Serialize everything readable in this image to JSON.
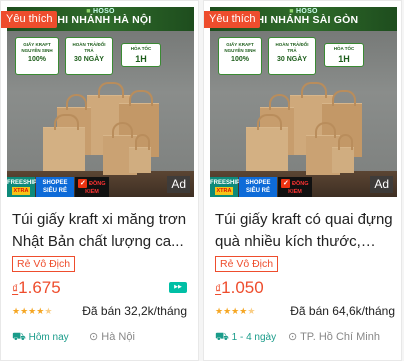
{
  "products": [
    {
      "favorite_label": "Yêu thích",
      "image": {
        "brand": "HOSO",
        "branch": "CHI NHÁNH HÀ NỘI",
        "badge1_small": "GIẤY KRAFT NGUYÊN SINH",
        "badge1_large": "100%",
        "badge2_small": "HOÀN TRẢ/ĐỔI TRẢ",
        "badge2_large": "30 NGÀY",
        "badge3_small": "HỎA TỐC",
        "badge3_large": "1H",
        "promo_freeship": "FREESHIP",
        "promo_freeship_x": "XTRA",
        "promo_shopee": "SHOPEE",
        "promo_sieure": "SIÊU RẺ",
        "promo_dongkiem": "ĐỒNG KIỂM",
        "ad_label": "Ad"
      },
      "title": "Túi giấy kraft xi măng trơn Nhật Bản chất lượng ca...",
      "tag": "Rẻ Vô Địch",
      "currency": "₫",
      "price": "1.675",
      "rating": 4.5,
      "sold": "Đã bán 32,2k/tháng",
      "shipping": "Hôm nay",
      "location": "Hà Nội"
    },
    {
      "favorite_label": "Yêu thích",
      "image": {
        "brand": "HOSO",
        "branch": "CHI NHÁNH SÀI GÒN",
        "badge1_small": "GIẤY KRAFT NGUYÊN SINH",
        "badge1_large": "100%",
        "badge2_small": "HOÀN TRẢ/ĐỔI TRẢ",
        "badge2_large": "30 NGÀY",
        "badge3_small": "HỎA TỐC",
        "badge3_large": "1H",
        "promo_freeship": "FREESHIP",
        "promo_freeship_x": "XTRA",
        "promo_shopee": "SHOPEE",
        "promo_sieure": "SIÊU RẺ",
        "promo_dongkiem": "ĐỒNG KIỂM",
        "ad_label": "Ad"
      },
      "title": "Túi giấy kraft có quai đựng quà nhiều kích thước, túi...",
      "tag": "Rẻ Vô Địch",
      "currency": "₫",
      "price": "1.050",
      "rating": 4.5,
      "sold": "Đã bán 64,6k/tháng",
      "shipping": "1 - 4 ngày",
      "location": "TP. Hồ Chí Minh"
    }
  ],
  "colors": {
    "accent": "#ee4d2d",
    "rating": "#f5a623",
    "shipping": "#1a9c8a"
  },
  "icons": {
    "stars": "star-icon",
    "truck": "truck-icon",
    "location": "location-pin-icon",
    "ship": "fast-delivery-icon"
  }
}
